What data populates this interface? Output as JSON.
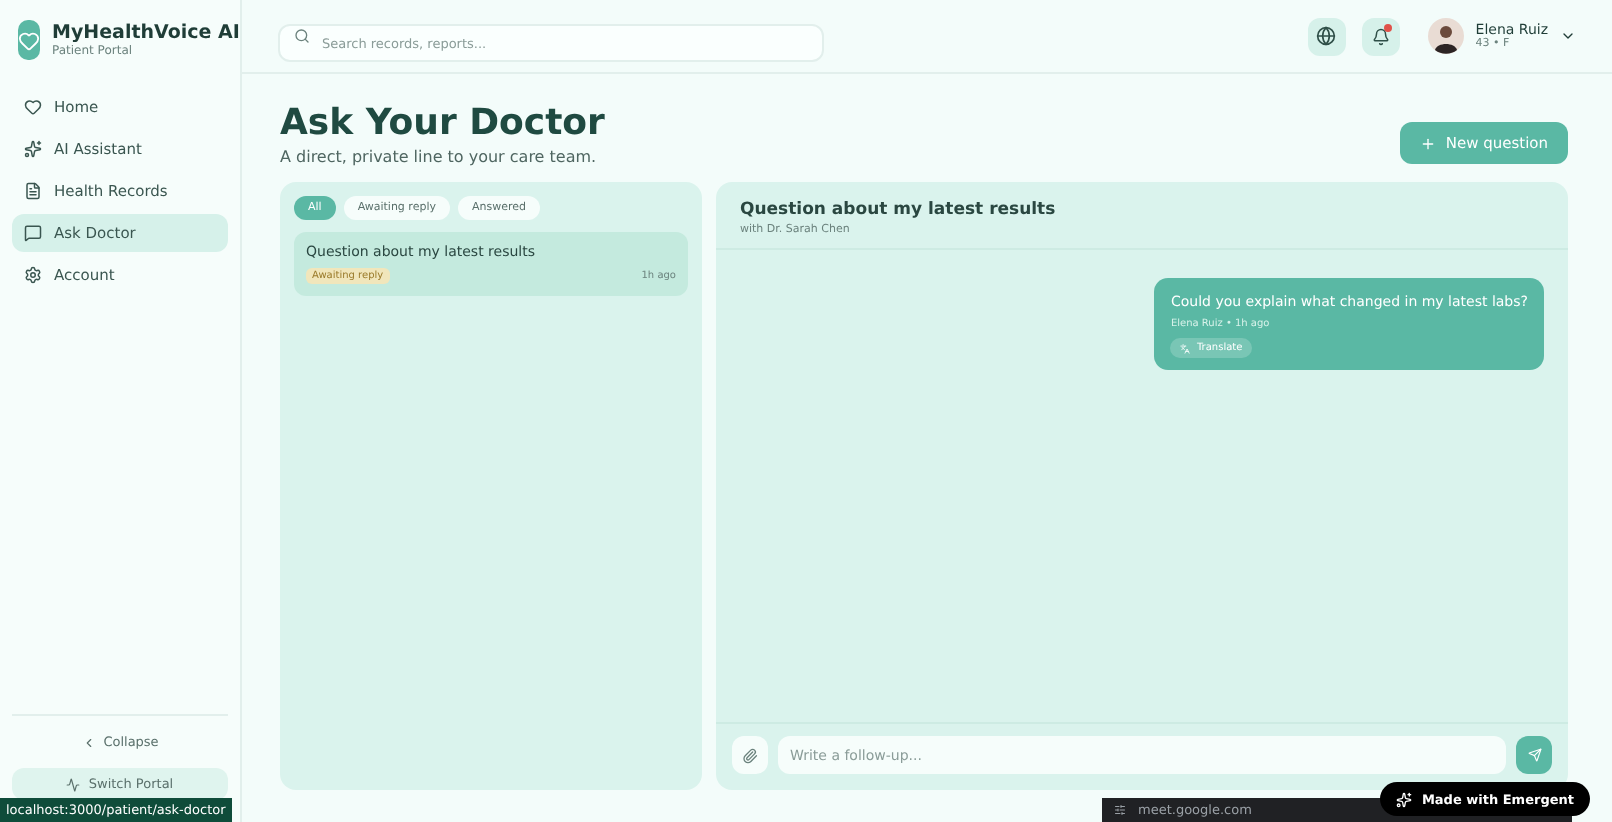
{
  "brand": {
    "title": "MyHealthVoice AI",
    "subtitle": "Patient Portal"
  },
  "nav": [
    {
      "label": "Home",
      "selected": false
    },
    {
      "label": "AI Assistant",
      "selected": false
    },
    {
      "label": "Health Records",
      "selected": false
    },
    {
      "label": "Ask Doctor",
      "selected": true
    },
    {
      "label": "Account",
      "selected": false
    }
  ],
  "sidebar_footer": {
    "collapse": "Collapse",
    "switch_portal": "Switch Portal"
  },
  "search": {
    "placeholder": "Search records, reports..."
  },
  "header": {
    "notification_unread": true,
    "user": {
      "name": "Elena Ruiz",
      "meta": "43 • F"
    }
  },
  "page": {
    "title": "Ask Your Doctor",
    "subtitle": "A direct, private line to your care team.",
    "new_button": "New question"
  },
  "filters": [
    {
      "label": "All",
      "selected": true
    },
    {
      "label": "Awaiting reply",
      "selected": false
    },
    {
      "label": "Answered",
      "selected": false
    }
  ],
  "questions": [
    {
      "title": "Question about my latest results",
      "status": "Awaiting reply",
      "time": "1h ago",
      "selected": true
    }
  ],
  "thread": {
    "title": "Question about my latest results",
    "subtitle": "with Dr. Sarah Chen",
    "messages": [
      {
        "text": "Could you explain what changed in my latest labs?",
        "meta": "Elena Ruiz • 1h ago",
        "action": "Translate"
      }
    ],
    "composer_placeholder": "Write a follow-up..."
  },
  "overlays": {
    "status_url": "localhost:3000/patient/ask-doctor",
    "badge": "Made with Emergent",
    "share_bar": "meet.google.com"
  }
}
